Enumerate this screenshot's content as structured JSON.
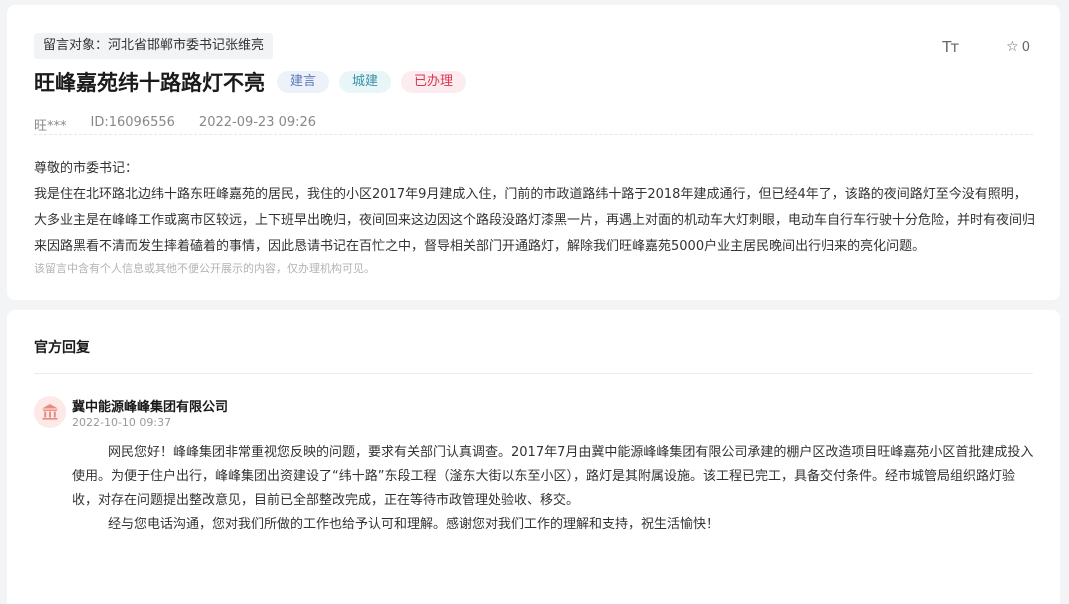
{
  "message": {
    "target": "留言对象：河北省邯郸市委书记张维亮",
    "font_size_icon": "Tт",
    "star_count": "0",
    "title": "旺峰嘉苑纬十路路灯不亮",
    "tags": [
      {
        "label": "建言",
        "color": "#5b7ab8"
      },
      {
        "label": "城建",
        "color": "#3b8fa6"
      },
      {
        "label": "已办理",
        "color": "#d9364f"
      }
    ],
    "author": "旺***",
    "id": "ID:16096556",
    "time": "2022-09-23 09:26",
    "greeting": "尊敬的市委书记：",
    "content": "我是住在北环路北边纬十路东旺峰嘉苑的居民，我住的小区2017年9月建成入住，门前的市政道路纬十路于2018年建成通行，但已经4年了，该路的夜间路灯至今没有照明，大多业主是在峰峰工作或离市区较远，上下班早出晚归，夜间回来这边因这个路段没路灯漆黑一片，再遇上对面的机动车大灯刺眼，电动车自行车行驶十分危险，并时有夜间归来因路黑看不清而发生摔着磕着的事情，因此恳请书记在百忙之中，督导相关部门开通路灯，解除我们旺峰嘉苑5000户业主居民晚间出行归来的亮化问题。",
    "privacy_hint": "该留言中含有个人信息或其他不便公开展示的内容，仅办理机构可见。"
  },
  "reply": {
    "heading": "官方回复",
    "org_name": "冀中能源峰峰集团有限公司",
    "org_icon": "bank-building-icon",
    "time": "2022-10-10 09:37",
    "paragraph1": "网民您好！峰峰集团非常重视您反映的问题，要求有关部门认真调查。2017年7月由冀中能源峰峰集团有限公司承建的棚户区改造项目旺峰嘉苑小区首批建成投入使用。为便于住户出行，峰峰集团出资建设了“纬十路”东段工程（滏东大街以东至小区），路灯是其附属设施。该工程已完工，具备交付条件。经市城管局组织路灯验收，对存在问题提出整改意见，目前已全部整改完成，正在等待市政管理处验收、移交。",
    "paragraph2": "经与您电话沟通，您对我们所做的工作也给予认可和理解。感谢您对我们工作的理解和支持，祝生活愉快！"
  }
}
